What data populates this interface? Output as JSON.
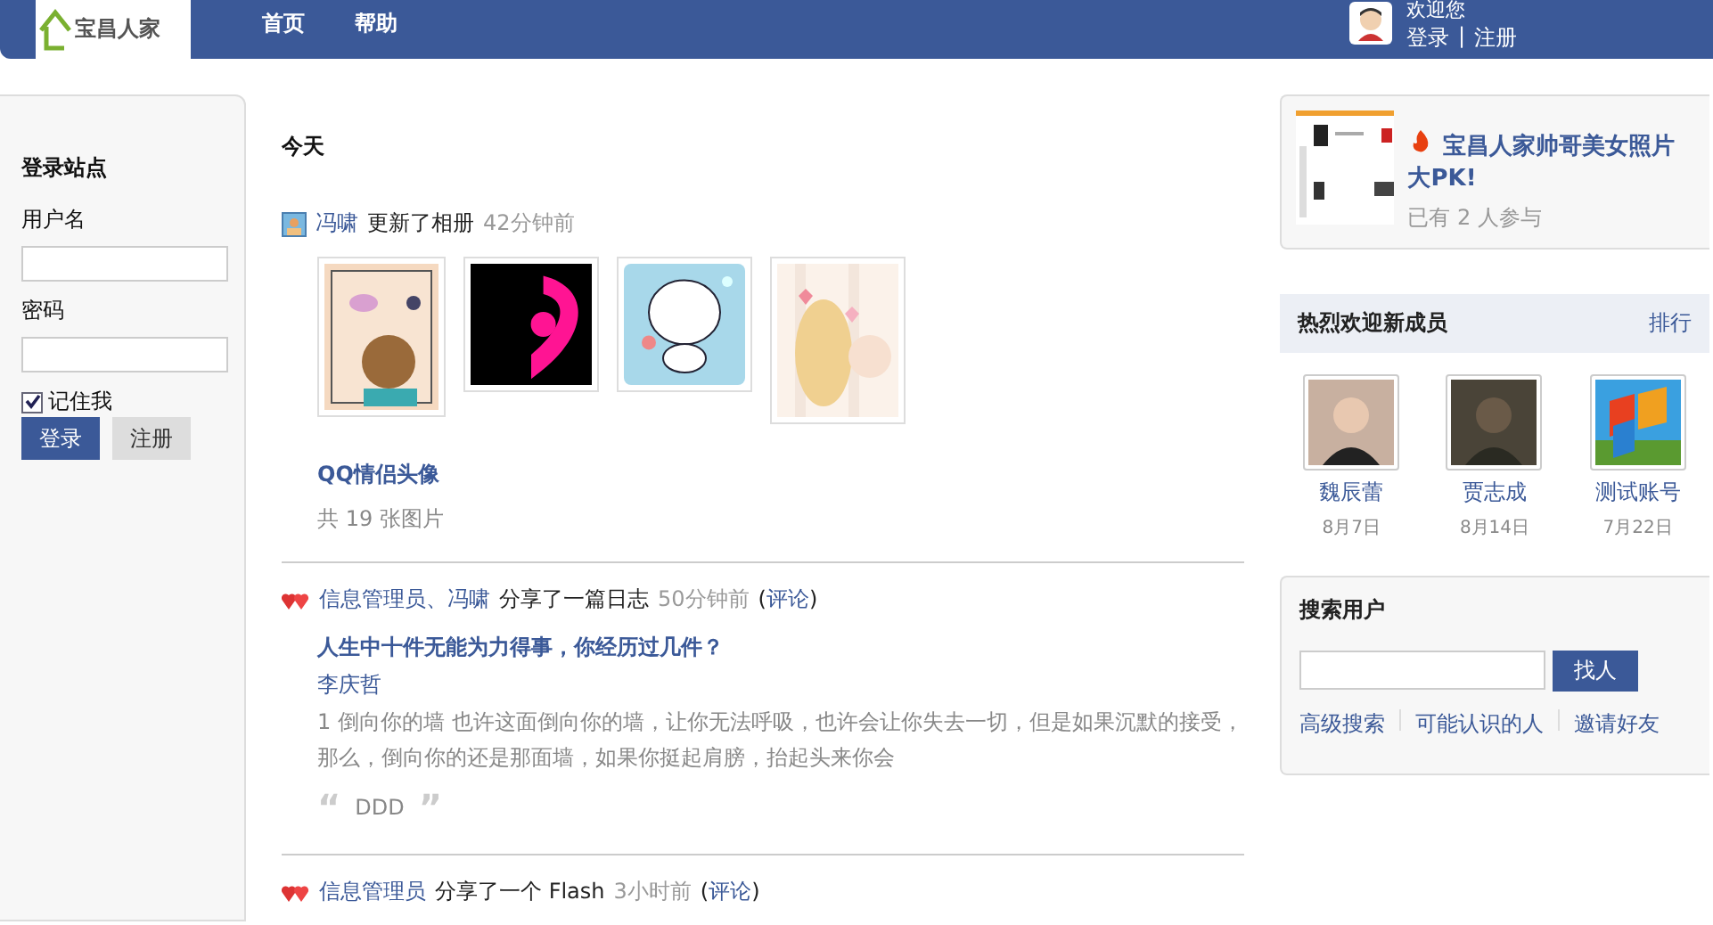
{
  "header": {
    "logo": "宝昌人家",
    "nav": [
      "首页",
      "帮助"
    ],
    "greeting": "欢迎您",
    "links": [
      "登录",
      "注册"
    ],
    "separator": "|"
  },
  "login": {
    "title": "登录站点",
    "username_label": "用户名",
    "password_label": "密码",
    "remember": {
      "label": "记住我",
      "checked": true
    },
    "buttons": [
      "登录",
      "注册"
    ]
  },
  "feed": {
    "day": "今天",
    "items": [
      {
        "kind": "album",
        "actors": "冯啸",
        "action": "更新了相册",
        "time": "42分钟前",
        "album_title": "QQ情侣头像",
        "count": "共 19 张图片"
      },
      {
        "kind": "blog",
        "actors": "信息管理员、冯啸",
        "action": "分享了一篇日志",
        "time": "50分钟前",
        "comment": {
          "open": "(",
          "link": "评论",
          "close": ")"
        },
        "title": "人生中十件无能为力得事，你经历过几件？",
        "author": "李庆哲",
        "excerpt": "1 倒向你的墙  也许这面倒向你的墙，让你无法呼吸，也许会让你失去一切，但是如果沉默的接受，那么，倒向你的还是那面墙，如果你挺起肩膀，抬起头来你会",
        "quote": "DDD",
        "quote_marks": [
          "“",
          "”"
        ]
      },
      {
        "kind": "share",
        "actors": "信息管理员",
        "action": "分享了一个 Flash",
        "time": "3小时前",
        "comment": {
          "open": "(",
          "link": "评论",
          "close": ")"
        }
      }
    ]
  },
  "promo": {
    "title": "宝昌人家帅哥美女照片大PK!",
    "participants": "已有 2 人参与"
  },
  "new_members": {
    "heading": "热烈欢迎新成员",
    "ranking": "排行",
    "members": [
      {
        "name": "魏辰蕾",
        "date": "8月7日"
      },
      {
        "name": "贾志成",
        "date": "8月14日"
      },
      {
        "name": "测试账号",
        "date": "7月22日"
      }
    ]
  },
  "search": {
    "heading": "搜索用户",
    "button": "找人",
    "links": [
      "高级搜索",
      "可能认识的人",
      "邀请好友"
    ]
  }
}
